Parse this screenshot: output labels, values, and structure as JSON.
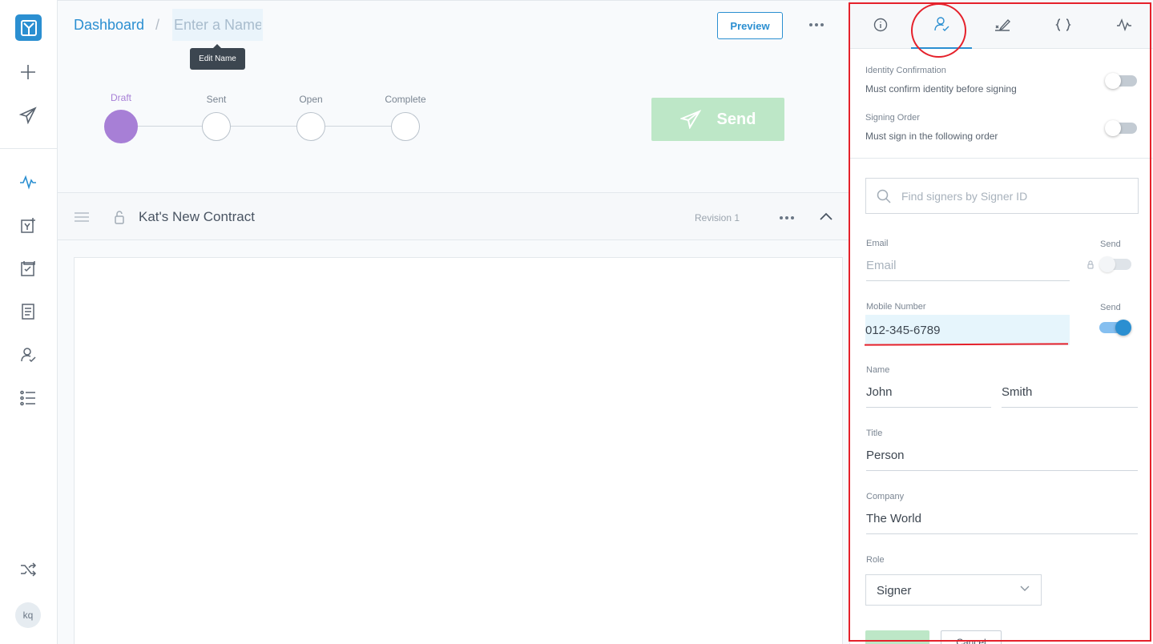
{
  "breadcrumb": {
    "dashboard": "Dashboard",
    "separator": "/"
  },
  "name_field": {
    "placeholder": "Enter a Name",
    "tooltip": "Edit Name"
  },
  "toolbar": {
    "preview_label": "Preview"
  },
  "steps": [
    {
      "label": "Draft",
      "active": true
    },
    {
      "label": "Sent",
      "active": false
    },
    {
      "label": "Open",
      "active": false
    },
    {
      "label": "Complete",
      "active": false
    }
  ],
  "send_button": {
    "label": "Send"
  },
  "document": {
    "title": "Kat's New Contract",
    "revision": "Revision 1"
  },
  "panel": {
    "tabs": [
      {
        "icon": "info-icon"
      },
      {
        "icon": "signer-icon",
        "active": true
      },
      {
        "icon": "signature-icon"
      },
      {
        "icon": "braces-icon"
      },
      {
        "icon": "activity-icon"
      }
    ],
    "identity": {
      "title": "Identity Confirmation",
      "desc": "Must confirm identity before signing",
      "enabled": false
    },
    "signing_order": {
      "title": "Signing Order",
      "desc": "Must sign in the following order",
      "enabled": false
    },
    "search": {
      "placeholder": "Find signers by Signer ID"
    },
    "email": {
      "label": "Email",
      "placeholder": "Email",
      "value": "",
      "send_label": "Send",
      "send_enabled": false
    },
    "mobile": {
      "label": "Mobile Number",
      "value": "012-345-6789",
      "send_label": "Send",
      "send_enabled": true
    },
    "name": {
      "label": "Name",
      "first": "John",
      "last": "Smith"
    },
    "title": {
      "label": "Title",
      "value": "Person"
    },
    "company": {
      "label": "Company",
      "value": "The World"
    },
    "role": {
      "label": "Role",
      "value": "Signer"
    },
    "cancel_label": "Cancel"
  },
  "user": {
    "initials": "kq"
  },
  "colors": {
    "accent": "#2b8fd1",
    "draft": "#a77fd6",
    "send_disabled": "#bde7c7",
    "annotation": "#e5212b"
  }
}
